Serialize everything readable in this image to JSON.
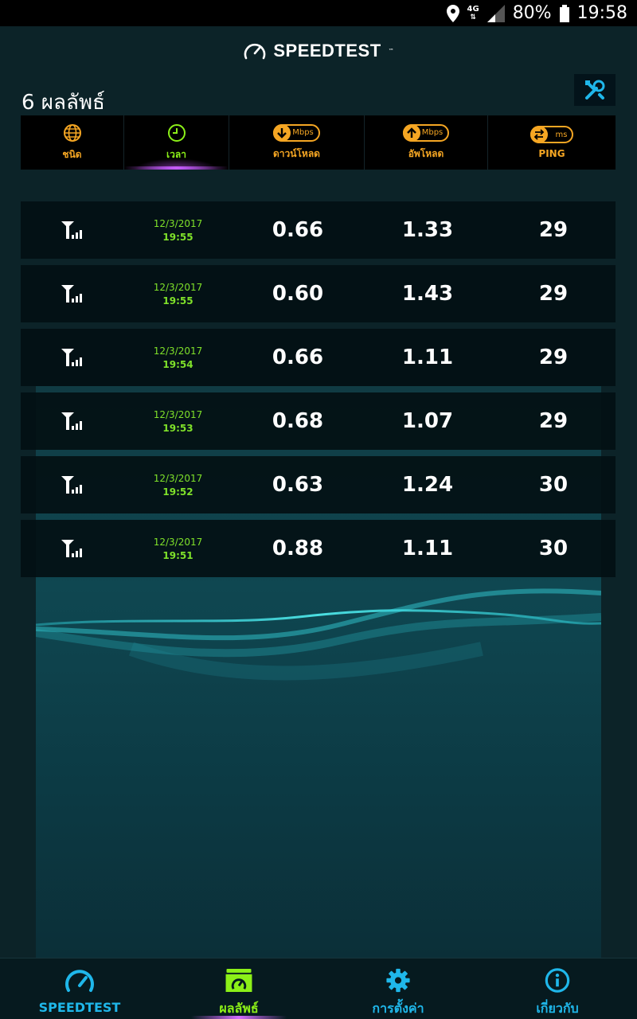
{
  "status_bar": {
    "network": "4G",
    "battery": "80%",
    "time": "19:58"
  },
  "header": {
    "brand": "SPEEDTEST",
    "trademark": "™"
  },
  "results": {
    "title": "6 ผลลัพธ์"
  },
  "columns": [
    {
      "label": "ชนิด",
      "icon": "globe-icon"
    },
    {
      "label": "เวลา",
      "icon": "clock-icon",
      "active": true
    },
    {
      "label": "ดาวน์โหลด",
      "icon": "download-icon",
      "unit": "Mbps"
    },
    {
      "label": "อัพโหลด",
      "icon": "upload-icon",
      "unit": "Mbps"
    },
    {
      "label": "PING",
      "icon": "ping-icon",
      "unit": "ms"
    }
  ],
  "rows": [
    {
      "type": "cellular-icon",
      "date": "12/3/2017",
      "time": "19:55",
      "download": "0.66",
      "upload": "1.33",
      "ping": "29"
    },
    {
      "type": "cellular-icon",
      "date": "12/3/2017",
      "time": "19:55",
      "download": "0.60",
      "upload": "1.43",
      "ping": "29"
    },
    {
      "type": "cellular-icon",
      "date": "12/3/2017",
      "time": "19:54",
      "download": "0.66",
      "upload": "1.11",
      "ping": "29"
    },
    {
      "type": "cellular-icon",
      "date": "12/3/2017",
      "time": "19:53",
      "download": "0.68",
      "upload": "1.07",
      "ping": "29"
    },
    {
      "type": "cellular-icon",
      "date": "12/3/2017",
      "time": "19:52",
      "download": "0.63",
      "upload": "1.24",
      "ping": "30"
    },
    {
      "type": "cellular-icon",
      "date": "12/3/2017",
      "time": "19:51",
      "download": "0.88",
      "upload": "1.11",
      "ping": "30"
    }
  ],
  "bottom_nav": [
    {
      "label": "SPEEDTEST",
      "icon": "speedometer-icon"
    },
    {
      "label": "ผลลัพธ์",
      "icon": "results-folder-icon",
      "active": true
    },
    {
      "label": "การตั้งค่า",
      "icon": "gear-icon"
    },
    {
      "label": "เกี่ยวกับ",
      "icon": "info-icon"
    }
  ],
  "colors": {
    "accent_orange": "#f5a623",
    "accent_green": "#8cf018",
    "accent_cyan": "#1fb7ea",
    "active_purple": "#c75cff"
  }
}
